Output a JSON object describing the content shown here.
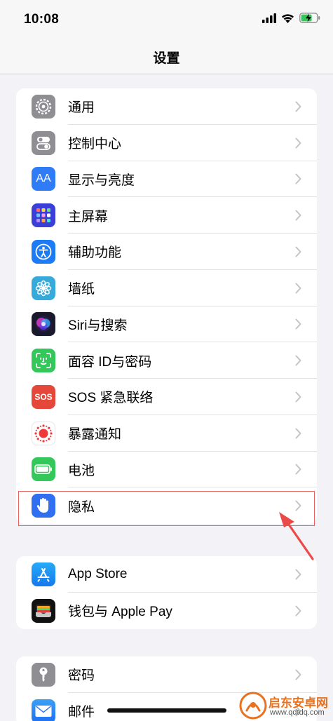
{
  "status_bar": {
    "time": "10:08",
    "icons": [
      "cellular-signal-icon",
      "wifi-icon",
      "battery-charging-icon"
    ]
  },
  "nav": {
    "title": "设置"
  },
  "groups": [
    [
      {
        "label": "通用",
        "icon": "gear-icon",
        "color": "#8e8e93"
      },
      {
        "label": "控制中心",
        "icon": "toggles-icon",
        "color": "#8e8e93"
      },
      {
        "label": "显示与亮度",
        "icon": "text-size-icon",
        "icon_text": "AA",
        "color": "#2f7cf6"
      },
      {
        "label": "主屏幕",
        "icon": "home-screen-grid-icon",
        "color": "#3a3fd8"
      },
      {
        "label": "辅助功能",
        "icon": "accessibility-icon",
        "color": "#1d7bf5"
      },
      {
        "label": "墙纸",
        "icon": "flower-icon",
        "color": "#37aadc"
      },
      {
        "label": "Siri与搜索",
        "icon": "siri-icon",
        "color": "#1a1a2e"
      },
      {
        "label": "面容 ID与密码",
        "icon": "face-id-icon",
        "color": "#34c759"
      },
      {
        "label": "SOS 紧急联络",
        "icon": "sos-icon",
        "icon_text": "SOS",
        "color": "#e5483a"
      },
      {
        "label": "暴露通知",
        "icon": "exposure-notification-icon",
        "color": "#ffffff"
      },
      {
        "label": "电池",
        "icon": "battery-icon",
        "color": "#34c759"
      },
      {
        "label": "隐私",
        "icon": "hand-icon",
        "color": "#2f6ff0"
      }
    ],
    [
      {
        "label": "App Store",
        "icon": "app-store-icon",
        "color": "#1b8cf0"
      },
      {
        "label": "钱包与 Apple Pay",
        "icon": "wallet-icon",
        "color": "#111111"
      }
    ],
    [
      {
        "label": "密码",
        "icon": "key-icon",
        "color": "#8e8e93"
      },
      {
        "label": "邮件",
        "icon": "mail-icon",
        "color": "#2d86f5"
      }
    ]
  ],
  "annotation": {
    "highlighted_item": "隐私",
    "color": "#e8605f"
  },
  "watermark": {
    "title": "启东安卓网",
    "url": "www.qdtdq.com"
  }
}
